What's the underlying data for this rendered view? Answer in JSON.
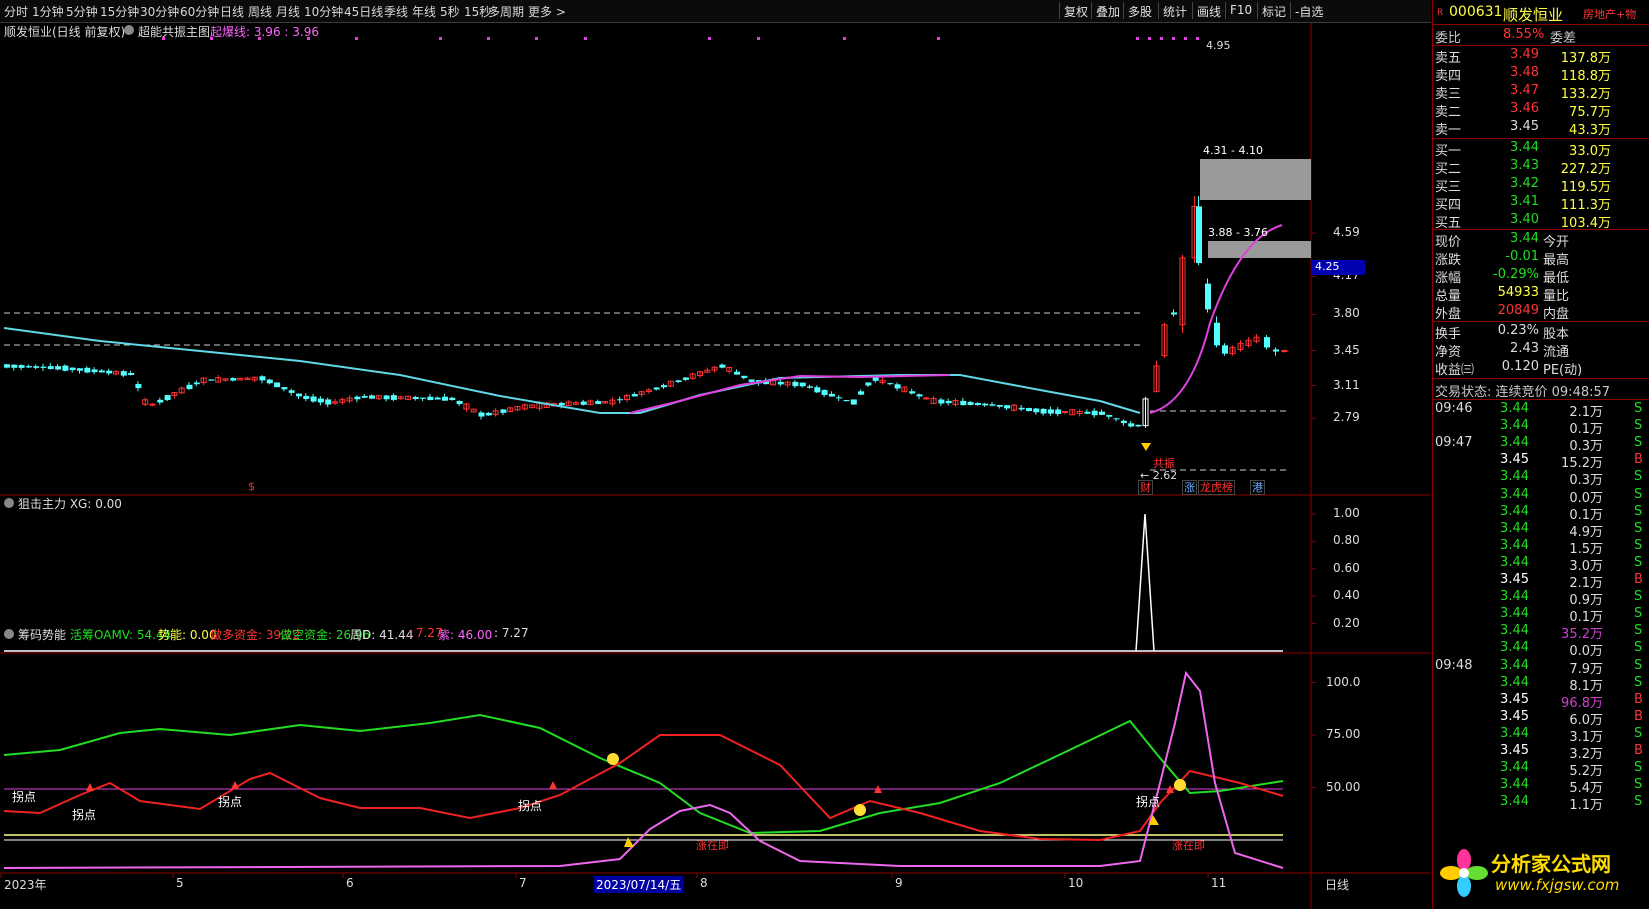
{
  "toolbar": {
    "periods": [
      "分时",
      "1分钟",
      "5分钟",
      "15分钟",
      "30分钟",
      "60分钟",
      "日线",
      "周线",
      "月线",
      "10分钟",
      "45日线",
      "季线",
      "年线",
      "5秒",
      "15秒",
      "多周期",
      "更多 >"
    ],
    "tools": [
      "复权",
      "叠加",
      "多股",
      "统计",
      "画线",
      "F10",
      "标记",
      "-自选"
    ]
  },
  "main_pane": {
    "title": "顺发恒业(日线 前复权)",
    "indicator": "超能共振主图",
    "indicator_line": "起爆线: 3.96 : 3.96",
    "y_ticks": [
      "4.59",
      "4.17",
      "3.80",
      "3.45",
      "3.11",
      "2.79"
    ],
    "current_price_tag": "4.25",
    "annotations": {
      "high": "4.95",
      "low": "2.62",
      "box1": "4.31 - 4.10",
      "box2": "3.88 - 3.76",
      "resonance": "共振",
      "markers": [
        "$",
        "财",
        "涨",
        "龙虎榜",
        "港"
      ]
    }
  },
  "pane2": {
    "title": "狙击主力 XG: 0.00",
    "y_ticks": [
      "1.00",
      "0.80",
      "0.60",
      "0.40",
      "0.20"
    ]
  },
  "pane3": {
    "title": "筹码势能",
    "values": [
      {
        "text": "活筹OAMV: 54.44",
        "color": "#22dd22"
      },
      {
        "text": "势能: 0.00",
        "color": "#ffff44"
      },
      {
        "text": "做多资金: 39.22",
        "color": "#ff3333"
      },
      {
        "text": "做空资金: 26.96",
        "color": "#22dd22"
      },
      {
        "text": "周D: 41.44",
        "color": "#dddddd"
      },
      {
        "text": ": 7.27",
        "color": "#ff3333"
      },
      {
        "text": "紫: 46.00",
        "color": "#ff66ff"
      },
      {
        "text": ": 7.27",
        "color": "#dddddd"
      }
    ],
    "y_ticks": [
      "100.0",
      "75.00",
      "50.00"
    ],
    "labels": {
      "turn": "拐点",
      "rise": "涨在即"
    }
  },
  "x_axis": {
    "labels": [
      "2023年",
      "5",
      "6",
      "7",
      "8",
      "9",
      "10",
      "11"
    ],
    "highlight": "2023/07/14/五",
    "period": "日线"
  },
  "quote": {
    "code": "000631",
    "name": "顺发恒业",
    "sector": "房地产+物",
    "webi_label": "委比",
    "webi_value": "8.55%",
    "weicha_label": "委差",
    "asks": [
      {
        "label": "卖五",
        "price": "3.49",
        "vol": "137.8万"
      },
      {
        "label": "卖四",
        "price": "3.48",
        "vol": "118.8万"
      },
      {
        "label": "卖三",
        "price": "3.47",
        "vol": "133.2万"
      },
      {
        "label": "卖二",
        "price": "3.46",
        "vol": "75.7万"
      },
      {
        "label": "卖一",
        "price": "3.45",
        "vol": "43.3万"
      }
    ],
    "bids": [
      {
        "label": "买一",
        "price": "3.44",
        "vol": "33.0万"
      },
      {
        "label": "买二",
        "price": "3.43",
        "vol": "227.2万"
      },
      {
        "label": "买三",
        "price": "3.42",
        "vol": "119.5万"
      },
      {
        "label": "买四",
        "price": "3.41",
        "vol": "111.3万"
      },
      {
        "label": "买五",
        "price": "3.40",
        "vol": "103.4万"
      }
    ],
    "stats": [
      {
        "l": "现价",
        "v": "3.44",
        "vc": "#22dd22",
        "r": "今开"
      },
      {
        "l": "涨跌",
        "v": "-0.01",
        "vc": "#22dd22",
        "r": "最高"
      },
      {
        "l": "涨幅",
        "v": "-0.29%",
        "vc": "#22dd22",
        "r": "最低"
      },
      {
        "l": "总量",
        "v": "54933",
        "vc": "#ffff44",
        "r": "量比"
      },
      {
        "l": "外盘",
        "v": "20849",
        "vc": "#ff3333",
        "r": "内盘"
      }
    ],
    "stats2": [
      {
        "l": "换手",
        "v": "0.23%",
        "r": "股本"
      },
      {
        "l": "净资",
        "v": "2.43",
        "r": "流通"
      },
      {
        "l": "收益㈢",
        "v": "0.120",
        "r": "PE(动)"
      }
    ],
    "trade_status": "交易状态: 连续竞价 09:48:57"
  },
  "ticks": [
    {
      "t": "09:46",
      "p": "3.44",
      "v": "2.1万",
      "s": "S"
    },
    {
      "t": "",
      "p": "3.44",
      "v": "0.1万",
      "s": "S"
    },
    {
      "t": "09:47",
      "p": "3.44",
      "v": "0.3万",
      "s": "S"
    },
    {
      "t": "",
      "p": "3.45",
      "v": "15.2万",
      "s": "B"
    },
    {
      "t": "",
      "p": "3.44",
      "v": "0.3万",
      "s": "S"
    },
    {
      "t": "",
      "p": "3.44",
      "v": "0.0万",
      "s": "S"
    },
    {
      "t": "",
      "p": "3.44",
      "v": "0.1万",
      "s": "S"
    },
    {
      "t": "",
      "p": "3.44",
      "v": "4.9万",
      "s": "S"
    },
    {
      "t": "",
      "p": "3.44",
      "v": "1.5万",
      "s": "S"
    },
    {
      "t": "",
      "p": "3.44",
      "v": "3.0万",
      "s": "S"
    },
    {
      "t": "",
      "p": "3.45",
      "v": "2.1万",
      "s": "B"
    },
    {
      "t": "",
      "p": "3.44",
      "v": "0.9万",
      "s": "S"
    },
    {
      "t": "",
      "p": "3.44",
      "v": "0.1万",
      "s": "S"
    },
    {
      "t": "",
      "p": "3.44",
      "v": "35.2万",
      "s": "S"
    },
    {
      "t": "",
      "p": "3.44",
      "v": "0.0万",
      "s": "S"
    },
    {
      "t": "09:48",
      "p": "3.44",
      "v": "7.9万",
      "s": "S"
    },
    {
      "t": "",
      "p": "3.44",
      "v": "8.1万",
      "s": "S"
    },
    {
      "t": "",
      "p": "3.45",
      "v": "96.8万",
      "s": "B"
    },
    {
      "t": "",
      "p": "3.45",
      "v": "6.0万",
      "s": "B"
    },
    {
      "t": "",
      "p": "3.44",
      "v": "3.1万",
      "s": "S"
    },
    {
      "t": "",
      "p": "3.45",
      "v": "3.2万",
      "s": "B"
    },
    {
      "t": "",
      "p": "3.44",
      "v": "5.2万",
      "s": "S"
    },
    {
      "t": "",
      "p": "3.44",
      "v": "5.4万",
      "s": "S"
    },
    {
      "t": "",
      "p": "3.44",
      "v": "1.1万",
      "s": "S"
    }
  ],
  "watermark": {
    "name": "分析家公式网",
    "url": "www.fxjgsw.com"
  },
  "colors": {
    "up": "#ff3333",
    "down": "#54ffff",
    "ma": "#60d8e8",
    "pink": "#e040e0",
    "green": "#22dd22",
    "yellow": "#ffff44"
  }
}
